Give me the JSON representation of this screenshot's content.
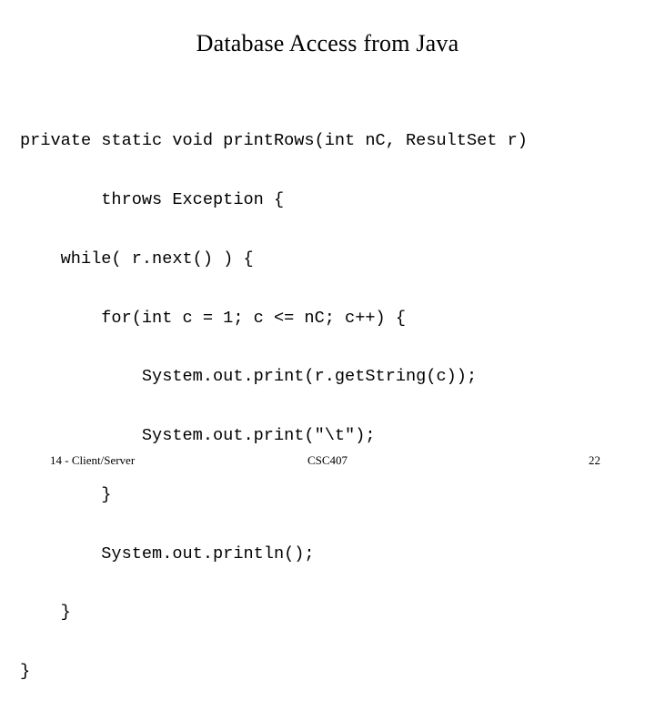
{
  "slide": {
    "title": "Database Access from Java",
    "background_color": "#ffffff",
    "text_color": "#000000",
    "code_lines": [
      "private static void printRows(int nC, ResultSet r)",
      "        throws Exception {",
      "    while( r.next() ) {",
      "        for(int c = 1; c <= nC; c++) {",
      "            System.out.print(r.getString(c));",
      "            System.out.print(\"\\t\");",
      "        }",
      "        System.out.println();",
      "    }",
      "}"
    ],
    "footer": {
      "left": "14 - Client/Server",
      "center": "CSC407",
      "right": "22"
    }
  }
}
